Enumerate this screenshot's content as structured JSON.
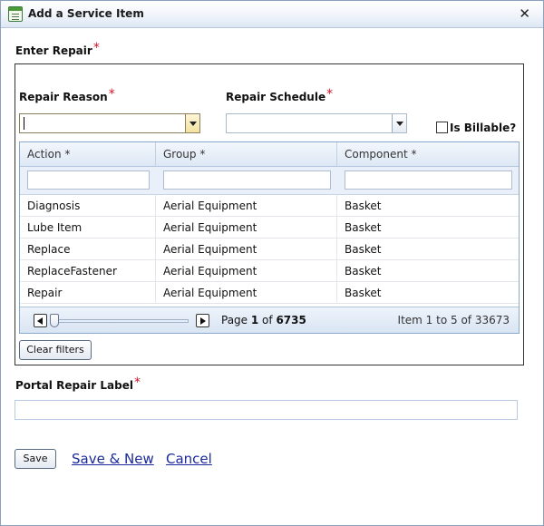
{
  "window": {
    "title": "Add a Service Item",
    "close_glyph": "✕",
    "icon": "form-icon"
  },
  "enter_repair": {
    "label": "Enter Repair",
    "required_mark": "*"
  },
  "repair_reason": {
    "label": "Repair Reason",
    "required_mark": "*",
    "value": ""
  },
  "repair_schedule": {
    "label": "Repair Schedule",
    "required_mark": "*",
    "value": ""
  },
  "is_billable": {
    "label": "Is Billable?",
    "checked": false
  },
  "grid": {
    "columns": [
      "Action *",
      "Group *",
      "Component *"
    ],
    "rows": [
      [
        "Diagnosis",
        "Aerial Equipment",
        "Basket"
      ],
      [
        "Lube Item",
        "Aerial Equipment",
        "Basket"
      ],
      [
        "Replace",
        "Aerial Equipment",
        "Basket"
      ],
      [
        "ReplaceFastener",
        "Aerial Equipment",
        "Basket"
      ],
      [
        "Repair",
        "Aerial Equipment",
        "Basket"
      ]
    ],
    "pager": {
      "page_prefix": "Page ",
      "current_page": "1",
      "of_word": " of ",
      "total_pages": "6735",
      "item_info": "Item 1 to 5 of 33673"
    }
  },
  "clear_filters_label": "Clear filters",
  "portal_repair_label": {
    "label": "Portal Repair Label",
    "required_mark": "*",
    "value": ""
  },
  "actions": {
    "save": "Save",
    "save_new": "Save & New",
    "cancel": "Cancel"
  },
  "colors": {
    "required": "#d0152a",
    "link": "#1a2a9a",
    "grid_border": "#8aa8cc"
  }
}
